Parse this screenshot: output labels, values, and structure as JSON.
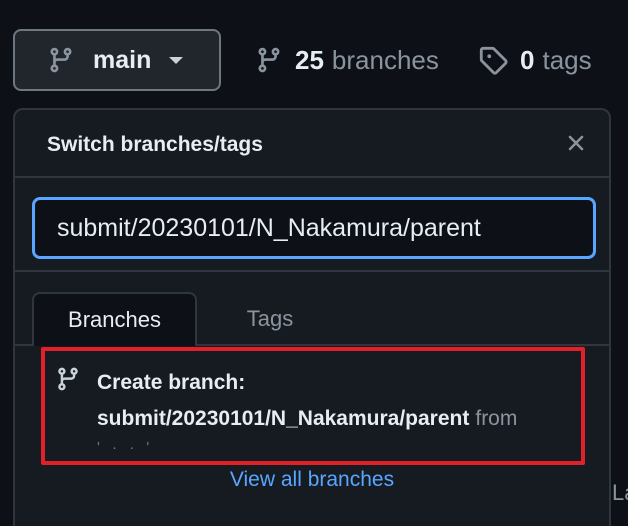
{
  "repo_bar": {
    "branch_selector_label": "main",
    "branches_count": "25",
    "branches_word": "branches",
    "tags_count": "0",
    "tags_word": "tags"
  },
  "dropdown": {
    "title": "Switch branches/tags",
    "search_value": "submit/20230101/N_Nakamura/parent",
    "tabs": [
      "Branches",
      "Tags"
    ],
    "active_tab": "Branches",
    "create_branch": {
      "label": "Create branch:",
      "branch_name": "submit/20230101/N_Nakamura/parent",
      "from_word": "from",
      "source_partial": "' ·  · '"
    },
    "view_all_label": "View all branches"
  },
  "background_fragments": [
    "La"
  ],
  "colors": {
    "background": "#0d1117",
    "panel": "#161b22",
    "border": "#30363d",
    "accent_blue": "#58a6ff",
    "highlight_red": "#e1202a",
    "muted": "#8b949e"
  },
  "icons": [
    "git-branch-icon",
    "tag-icon",
    "close-icon",
    "caret-down-icon"
  ]
}
